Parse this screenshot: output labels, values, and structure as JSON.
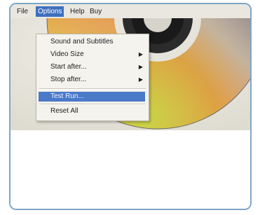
{
  "menubar": {
    "file": "File",
    "options": "Options",
    "help": "Help",
    "buy": "Buy"
  },
  "options_menu": {
    "items": [
      {
        "label": "Sound and Subtitles",
        "submenu": false
      },
      {
        "label": "Video Size",
        "submenu": true
      },
      {
        "label": "Start after...",
        "submenu": true
      },
      {
        "label": "Stop after...",
        "submenu": true
      },
      {
        "label": "Test Run...",
        "submenu": false,
        "selected": true
      },
      {
        "label": "Reset All",
        "submenu": false
      }
    ],
    "submenu_arrow": "▶"
  },
  "colors": {
    "menu_highlight": "#4a79c8",
    "frame_border": "#7fa6c8"
  }
}
